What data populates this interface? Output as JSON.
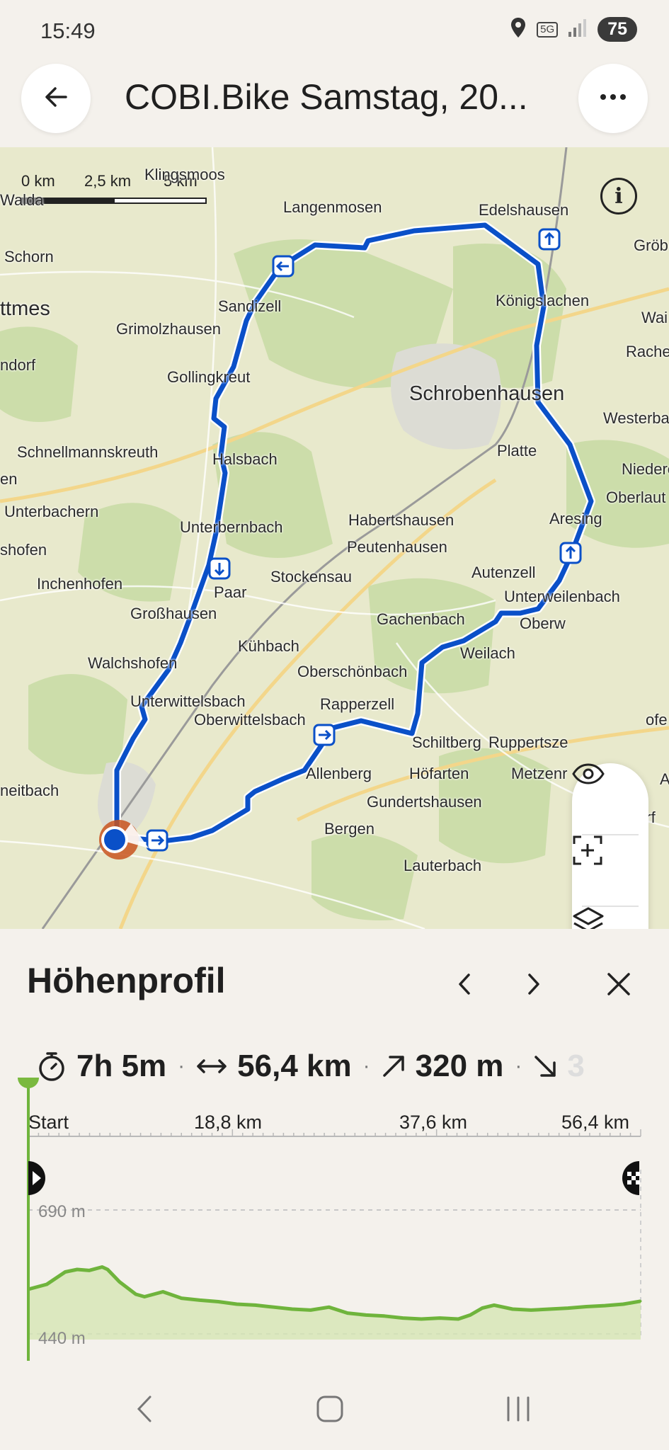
{
  "status_bar": {
    "time": "15:49",
    "network": "5G",
    "battery": "75"
  },
  "header": {
    "title": "COBI.Bike Samstag, 20..."
  },
  "map": {
    "scale_labels": [
      "0 km",
      "2,5 km",
      "5 km"
    ],
    "places": [
      {
        "name": "Klingsmoos",
        "big": false
      },
      {
        "name": "Walda",
        "big": false
      },
      {
        "name": "Langenmosen",
        "big": false
      },
      {
        "name": "Edelshausen",
        "big": false
      },
      {
        "name": "Gröb",
        "big": false
      },
      {
        "name": "Schorn",
        "big": false
      },
      {
        "name": "ttmes",
        "big": true
      },
      {
        "name": "Sandizell",
        "big": false
      },
      {
        "name": "Königslachen",
        "big": false
      },
      {
        "name": "Wai",
        "big": false
      },
      {
        "name": "Grimolzhausen",
        "big": false
      },
      {
        "name": "Rache",
        "big": false
      },
      {
        "name": "ndorf",
        "big": false
      },
      {
        "name": "Gollingkreut",
        "big": false
      },
      {
        "name": "Schrobenhausen",
        "big": true
      },
      {
        "name": "Westerba",
        "big": false
      },
      {
        "name": "Schnellmannskreuth",
        "big": false
      },
      {
        "name": "Halsbach",
        "big": false
      },
      {
        "name": "Platte",
        "big": false
      },
      {
        "name": "Niedere",
        "big": false
      },
      {
        "name": "en",
        "big": false
      },
      {
        "name": "Oberlaut",
        "big": false
      },
      {
        "name": "Unterbachern",
        "big": false
      },
      {
        "name": "Unterbernbach",
        "big": false
      },
      {
        "name": "Habertshausen",
        "big": false
      },
      {
        "name": "Aresing",
        "big": false
      },
      {
        "name": "shofen",
        "big": false
      },
      {
        "name": "Peutenhausen",
        "big": false
      },
      {
        "name": "Stockensau",
        "big": false
      },
      {
        "name": "Inchenhofen",
        "big": false
      },
      {
        "name": "Autenzell",
        "big": false
      },
      {
        "name": "Paar",
        "big": false
      },
      {
        "name": "Unterweilenbach",
        "big": false
      },
      {
        "name": "Großhausen",
        "big": false
      },
      {
        "name": "Gachenbach",
        "big": false
      },
      {
        "name": "Oberw",
        "big": false
      },
      {
        "name": "Kühbach",
        "big": false
      },
      {
        "name": "Weilach",
        "big": false
      },
      {
        "name": "Walchshofen",
        "big": false
      },
      {
        "name": "Oberschönbach",
        "big": false
      },
      {
        "name": "Unterwittelsbach",
        "big": false
      },
      {
        "name": "Rapperzell",
        "big": false
      },
      {
        "name": "Oberwittelsbach",
        "big": false
      },
      {
        "name": "ofe",
        "big": false
      },
      {
        "name": "Schiltberg",
        "big": false
      },
      {
        "name": "Ruppertsze",
        "big": false
      },
      {
        "name": "A",
        "big": false
      },
      {
        "name": "Allenberg",
        "big": false
      },
      {
        "name": "Höfarten",
        "big": false
      },
      {
        "name": "Metzenr",
        "big": false
      },
      {
        "name": "neitbach",
        "big": false
      },
      {
        "name": "Gundertshausen",
        "big": false
      },
      {
        "name": "Bergen",
        "big": false
      },
      {
        "name": "Lauterbach",
        "big": false
      },
      {
        "name": "Ochsendorf",
        "big": false
      }
    ],
    "info_icon": "info-icon",
    "tools": [
      "eye-icon",
      "add-frame-icon",
      "layers-icon",
      "navigate-icon"
    ],
    "route_color": "#0a50c8"
  },
  "elevation": {
    "title": "Höhenprofil",
    "stats": {
      "duration": "7h 5m",
      "distance": "56,4 km",
      "ascent": "320 m",
      "descent": "3"
    },
    "x_ticks": [
      "Start",
      "18,8 km",
      "37,6 km",
      "56,4 km"
    ],
    "y_max_label": "690 m",
    "y_min_label": "440 m",
    "profile_color": "#6fb43c"
  },
  "chart_data": {
    "type": "area",
    "title": "Höhenprofil",
    "xlabel": "",
    "ylabel": "",
    "x_unit": "km",
    "y_unit": "m",
    "xlim": [
      0,
      56.4
    ],
    "ylim": [
      440,
      690
    ],
    "x": [
      0,
      1.7,
      3.4,
      4.5,
      5.6,
      6.8,
      7.3,
      8.4,
      9.9,
      10.7,
      12.4,
      14.1,
      15.8,
      17.5,
      19.2,
      20.9,
      22.6,
      24.3,
      26.0,
      27.7,
      29.4,
      31.1,
      32.8,
      34.5,
      36.2,
      37.9,
      39.6,
      40.7,
      41.8,
      42.9,
      44.6,
      46.3,
      48.0,
      49.7,
      51.4,
      53.1,
      54.8,
      56.4
    ],
    "series": [
      {
        "values": [
          530,
          540,
          565,
          570,
          568,
          575,
          570,
          545,
          520,
          515,
          525,
          512,
          508,
          505,
          500,
          498,
          494,
          490,
          488,
          494,
          482,
          478,
          476,
          472,
          470,
          472,
          470,
          478,
          492,
          498,
          490,
          488,
          490,
          492,
          495,
          497,
          500,
          506
        ]
      }
    ]
  },
  "nav_bar": {
    "buttons": [
      "back-nav-icon",
      "home-nav-icon",
      "recents-nav-icon"
    ]
  }
}
